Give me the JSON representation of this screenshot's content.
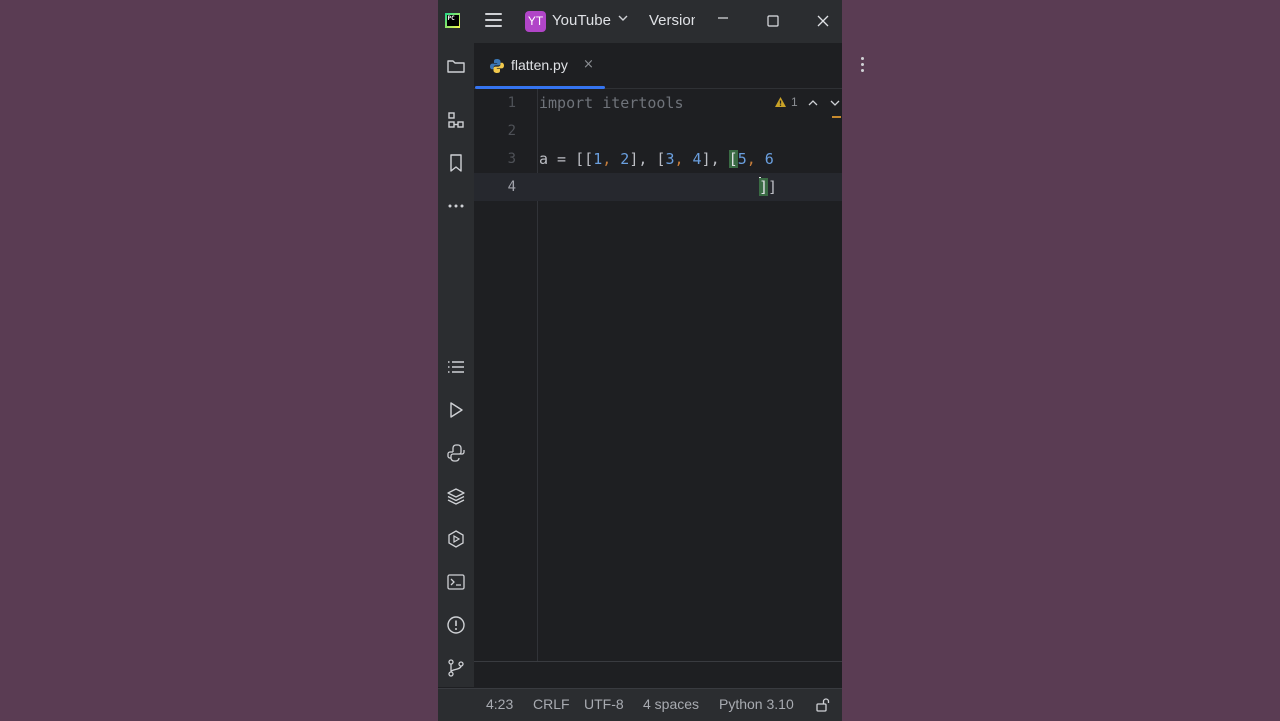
{
  "titlebar": {
    "app_logo": "PC",
    "menu_icon": "hamburger-icon",
    "project_badge": "YT",
    "project_name": "YouTube",
    "vcs_label": "Version",
    "badge_color": "#b145c8"
  },
  "toolstrip": {
    "top_tools": [
      "project-folder-icon",
      "structure-icon",
      "bookmarks-icon",
      "more-icon"
    ],
    "bottom_tools": [
      "todo-list-icon",
      "run-icon",
      "python-console-icon",
      "layers-icon",
      "services-icon",
      "terminal-icon",
      "problems-icon",
      "git-icon"
    ]
  },
  "tabs": [
    {
      "label": "flatten.py",
      "icon": "python-file-icon",
      "close": "×"
    }
  ],
  "editor": {
    "lines": [
      {
        "number": "1",
        "text": "import itertools"
      },
      {
        "number": "2",
        "text": ""
      },
      {
        "number": "3",
        "text": "a = [[1, 2], [3, 4], [5, 6"
      },
      {
        "number": "4",
        "text": "]]"
      }
    ],
    "warning_count": "1",
    "line3": {
      "a": "a = ",
      "open": "[[",
      "n1": "1",
      "c1": ", ",
      "n2": "2",
      "close1": "], ",
      "open2": "[",
      "n3": "3",
      "c2": ", ",
      "n4": "4",
      "close2": "], ",
      "open3": "[",
      "n5": "5",
      "c3": ", ",
      "n6": "6"
    },
    "line4": {
      "b1": "]",
      "b2": "]"
    },
    "accent": "#3574f0"
  },
  "statusbar": {
    "position": "4:23",
    "line_ending": "CRLF",
    "encoding": "UTF-8",
    "indent": "4 spaces",
    "interpreter": "Python 3.10"
  }
}
